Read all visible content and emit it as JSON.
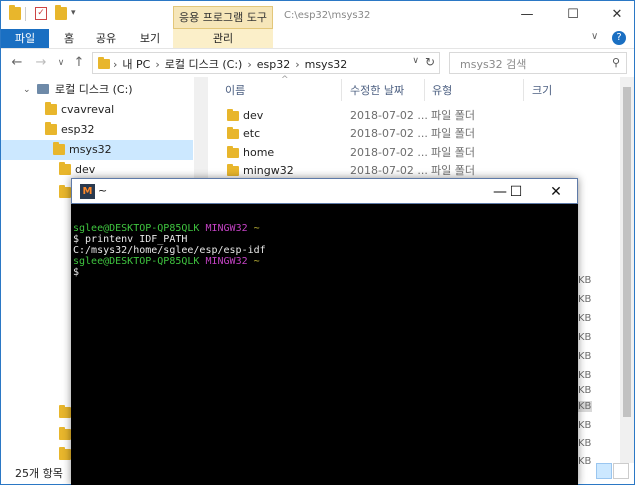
{
  "explorer": {
    "window_title_path": "C:\\esp32\\msys32",
    "context_tab": "응용 프로그램 도구",
    "ribbon_tabs": [
      "파일",
      "홈",
      "공유",
      "보기",
      "관리"
    ],
    "breadcrumb": [
      "내 PC",
      "로컬 디스크 (C:)",
      "esp32",
      "msys32"
    ],
    "search_placeholder": "msys32 검색",
    "nav_items": [
      {
        "label": "로컬 디스크 (C:)"
      },
      {
        "label": "cvavreval"
      },
      {
        "label": "esp32"
      },
      {
        "label": "msys32",
        "selected": true
      },
      {
        "label": "dev"
      }
    ],
    "columns": {
      "name": "이름",
      "date": "수정한 날짜",
      "type": "유형",
      "size": "크기"
    },
    "rows": [
      {
        "name": "dev",
        "date": "2018-07-02 ...",
        "type": "파일 폴더"
      },
      {
        "name": "etc",
        "date": "2018-07-02 ...",
        "type": "파일 폴더"
      },
      {
        "name": "home",
        "date": "2018-07-02 ...",
        "type": "파일 폴더"
      },
      {
        "name": "mingw32",
        "date": "2018-07-02 ...",
        "type": "파일 폴더"
      }
    ],
    "size_unit": "KB",
    "status": "25개 항목"
  },
  "terminal": {
    "title": "~",
    "lines": [
      {
        "user": "sglee@DESKTOP-QP85QLK",
        "env": "MINGW32",
        "dir": "~"
      },
      {
        "text": "$ printenv IDF_PATH"
      },
      {
        "text": "C:/msys32/home/sglee/esp/esp-idf"
      },
      {
        "text": ""
      },
      {
        "user": "sglee@DESKTOP-QP85QLK",
        "env": "MINGW32",
        "dir": "~"
      },
      {
        "text": "$"
      }
    ]
  },
  "colors": {
    "accent": "#1a6fc2",
    "folder": "#e8b62c",
    "prompt_user": "#3fc43f",
    "prompt_env": "#c342c3",
    "prompt_dir": "#c9bf3a"
  }
}
